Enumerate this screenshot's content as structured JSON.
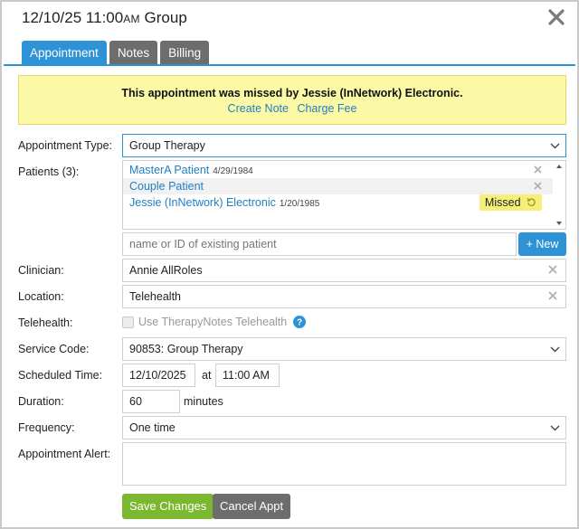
{
  "header": {
    "date": "12/10/25",
    "time": "11:00",
    "ampm": "AM",
    "title": "Group"
  },
  "tabs": [
    {
      "label": "Appointment",
      "active": true
    },
    {
      "label": "Notes",
      "active": false
    },
    {
      "label": "Billing",
      "active": false
    }
  ],
  "alert": {
    "message": "This appointment was missed by Jessie (InNetwork) Electronic.",
    "create_note": "Create Note",
    "charge_fee": "Charge Fee"
  },
  "form": {
    "appointment_type": {
      "label": "Appointment Type:",
      "value": "Group Therapy"
    },
    "patients": {
      "label": "Patients (3):",
      "items": [
        {
          "name": "MasterA Patient",
          "dob": "4/29/1984"
        },
        {
          "name": "Couple Patient",
          "dob": ""
        },
        {
          "name": "Jessie (InNetwork) Electronic",
          "dob": "1/20/1985",
          "status": "Missed"
        }
      ],
      "search_placeholder": "name or ID of existing patient",
      "new_label": "+ New"
    },
    "clinician": {
      "label": "Clinician:",
      "value": "Annie AllRoles"
    },
    "location": {
      "label": "Location:",
      "value": "Telehealth"
    },
    "telehealth": {
      "label": "Telehealth:",
      "checkbox_label": "Use TherapyNotes Telehealth"
    },
    "service_code": {
      "label": "Service Code:",
      "value": "90853: Group Therapy"
    },
    "scheduled_time": {
      "label": "Scheduled Time:",
      "date": "12/10/2025",
      "at": "at",
      "time": "11:00 AM"
    },
    "duration": {
      "label": "Duration:",
      "value": "60",
      "unit": "minutes"
    },
    "frequency": {
      "label": "Frequency:",
      "value": "One time"
    },
    "appointment_alert": {
      "label": "Appointment Alert:",
      "value": ""
    }
  },
  "buttons": {
    "save": "Save Changes",
    "cancel": "Cancel Appt"
  },
  "colors": {
    "accent": "#2e93d6",
    "alert_bg": "#fcf9a6",
    "save": "#7cb82f",
    "link": "#1f7fc2"
  }
}
